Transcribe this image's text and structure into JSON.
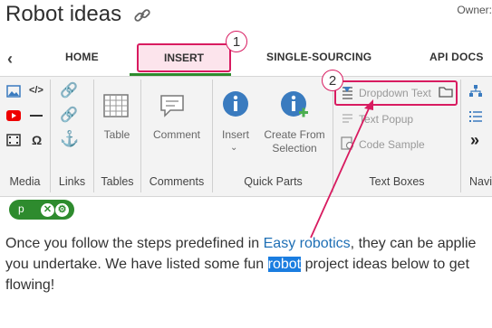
{
  "page": {
    "title": "Robot ideas",
    "owners_label": "Owner:"
  },
  "tabs": [
    "HOME",
    "INSERT",
    "SINGLE-SOURCING",
    "API DOCS"
  ],
  "ribbon": {
    "groups": {
      "media": "Media",
      "links": "Links",
      "tables": "Tables",
      "comments": "Comments",
      "quick_parts": "Quick Parts",
      "text_boxes": "Text Boxes",
      "navigation": "Navi"
    },
    "buttons": {
      "table": "Table",
      "comment": "Comment",
      "insert": "Insert",
      "create_from_selection_1": "Create From",
      "create_from_selection_2": "Selection"
    },
    "text_boxes": {
      "dropdown_text": "Dropdown Text",
      "text_popup": "Text Popup",
      "code_sample": "Code Sample"
    },
    "more": "»"
  },
  "tag_pill": {
    "label": "p"
  },
  "callouts": {
    "one": "1",
    "two": "2"
  },
  "content": {
    "t1": "Once you follow the steps predefined in ",
    "link": "Easy robotics",
    "t2": ", they can be applie",
    "t3": "you undertake. We have listed some fun ",
    "selected": "robot",
    "t4": " project ideas below to get",
    "t5": "flowing!"
  },
  "colors": {
    "accent": "#d81b60",
    "green": "#2e8b2e",
    "link": "#1e6fb5",
    "info_blue": "#3a7bbf"
  }
}
